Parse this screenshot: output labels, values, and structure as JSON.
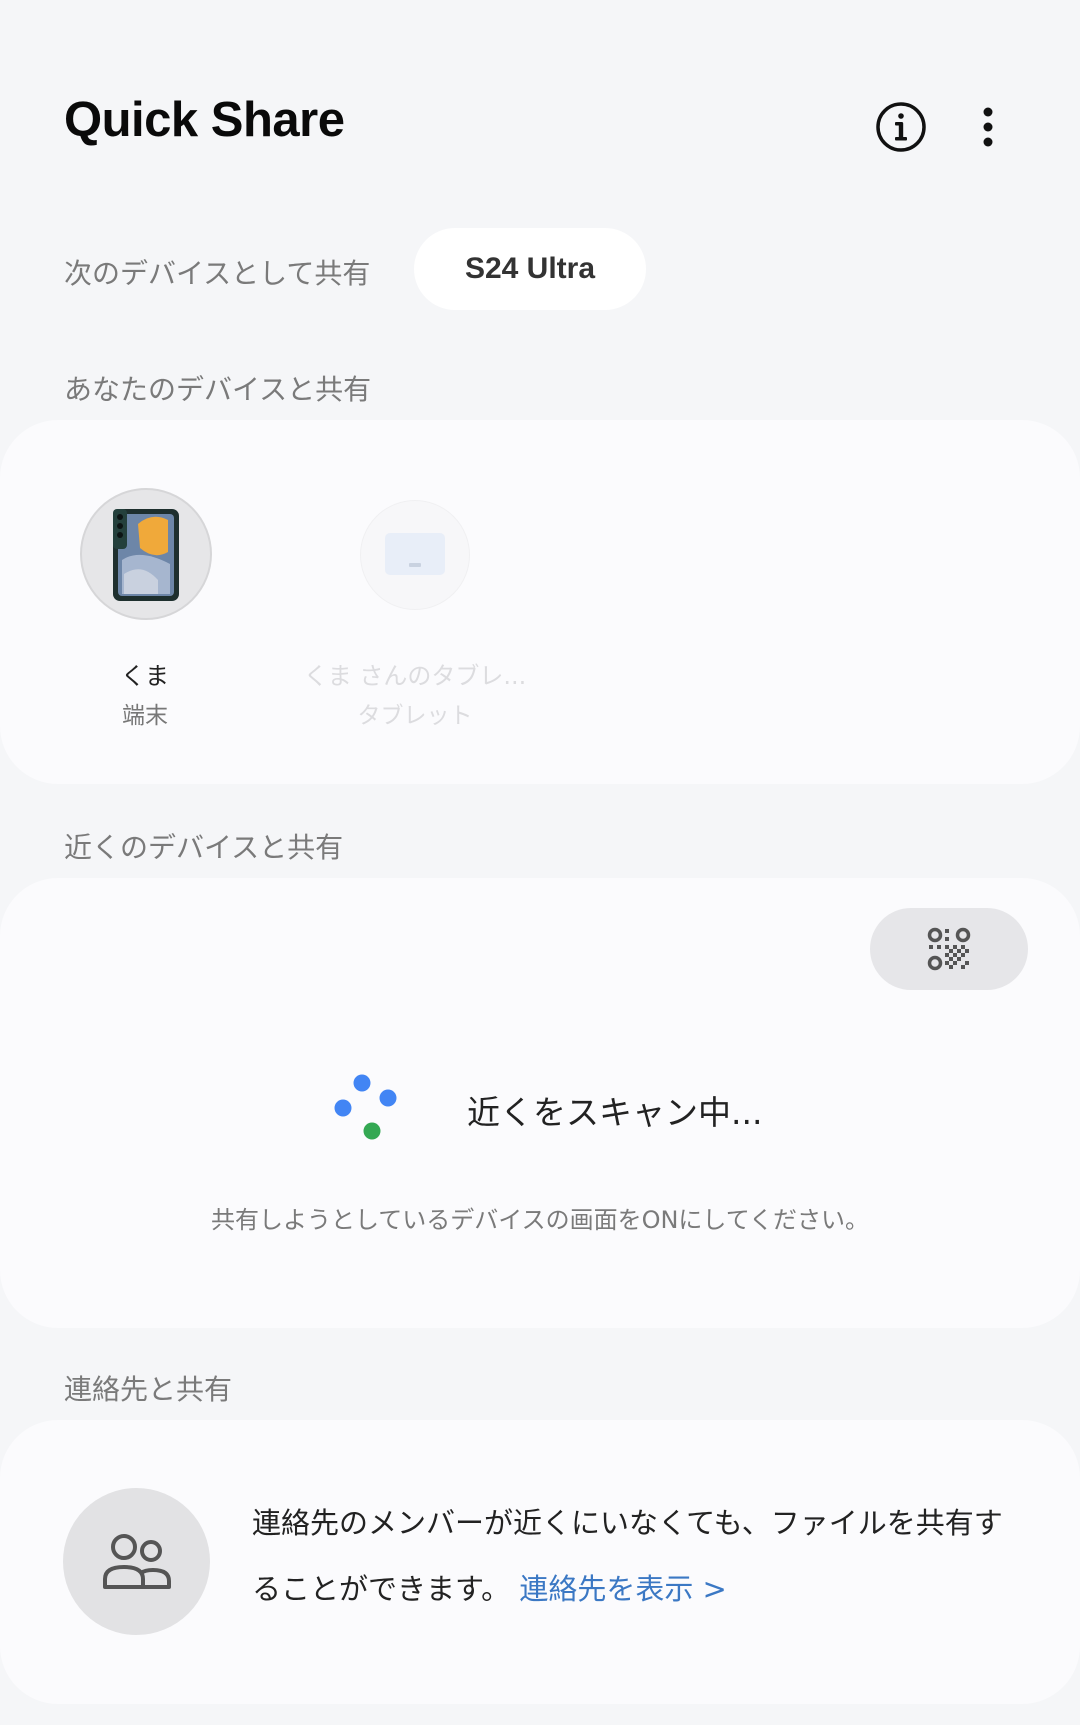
{
  "header": {
    "title": "Quick Share",
    "info_icon": "info-icon",
    "more_icon": "more-vertical-icon"
  },
  "share_as": {
    "label": "次のデバイスとして共有",
    "device_name": "S24 Ultra"
  },
  "my_devices": {
    "section_label": "あなたのデバイスと共有",
    "devices": [
      {
        "name": "くま",
        "type": "端末",
        "icon": "phone-image",
        "enabled": true
      },
      {
        "name": "くま さんのタブレ...",
        "type": "タブレット",
        "icon": "tablet-icon",
        "enabled": false
      }
    ]
  },
  "nearby": {
    "section_label": "近くのデバイスと共有",
    "qr_icon": "qr-code-icon",
    "scan_text": "近くをスキャン中...",
    "hint": "共有しようとしているデバイスの画面をONにしてください。",
    "dot_colors": [
      "#4285f4",
      "#4285f4",
      "#4285f4",
      "#34a853"
    ]
  },
  "contacts": {
    "section_label": "連絡先と共有",
    "avatar_icon": "people-icon",
    "description": "連絡先のメンバーが近くにいなくても、ファイルを共有することができます。",
    "link": "連絡先を表示 >"
  }
}
